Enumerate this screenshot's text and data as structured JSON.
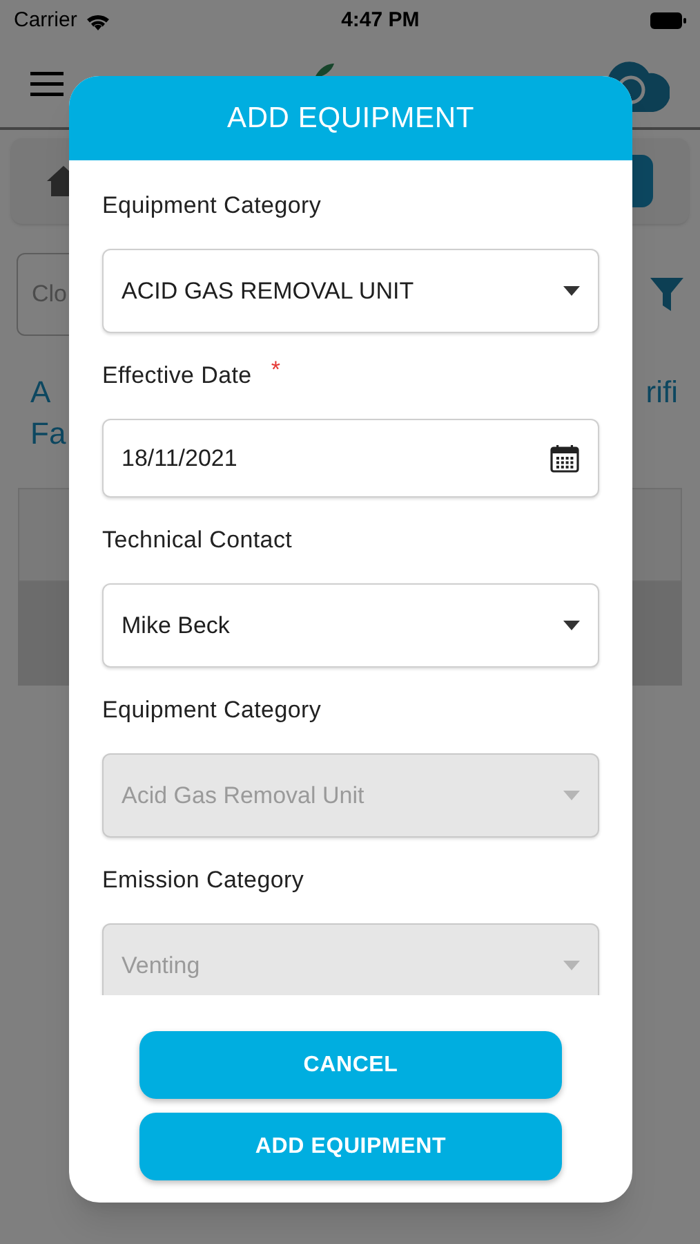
{
  "status_bar": {
    "carrier": "Carrier",
    "time": "4:47 PM"
  },
  "background": {
    "search": {
      "placeholder": "Clo"
    },
    "title_fragments": [
      "A",
      "rifi",
      "Fa"
    ]
  },
  "dialog": {
    "title": "ADD EQUIPMENT",
    "fields": [
      {
        "kind": "select",
        "label": "Equipment Category",
        "value": "ACID GAS REMOVAL UNIT",
        "disabled": false
      },
      {
        "kind": "date",
        "label": "Effective Date",
        "required_mark": "*",
        "value": "18/11/2021",
        "disabled": false
      },
      {
        "kind": "select",
        "label": "Technical Contact",
        "value": "Mike Beck",
        "disabled": false
      },
      {
        "kind": "select",
        "label": "Equipment Category",
        "value": "Acid Gas Removal Unit",
        "disabled": true
      },
      {
        "kind": "select",
        "label": "Emission Category",
        "value": "Venting",
        "disabled": true
      }
    ],
    "buttons": [
      "CANCEL",
      "ADD EQUIPMENT"
    ]
  }
}
